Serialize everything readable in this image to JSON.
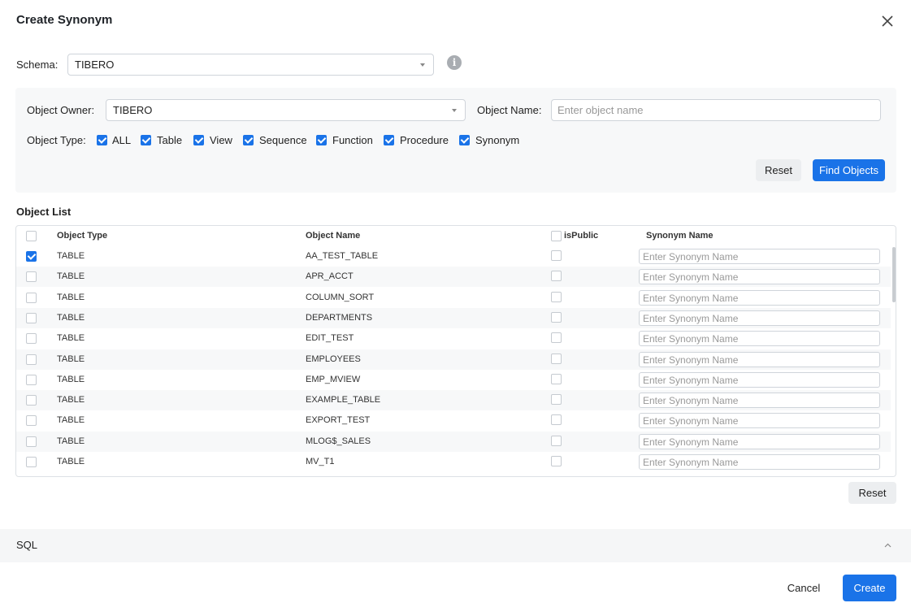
{
  "dialog": {
    "title": "Create Synonym"
  },
  "schema": {
    "label": "Schema:",
    "value": "TIBERO",
    "info_icon": "info-icon"
  },
  "search": {
    "owner_label": "Object Owner:",
    "owner_value": "TIBERO",
    "name_label": "Object Name:",
    "name_placeholder": "Enter object name",
    "type_label": "Object Type:",
    "types": [
      {
        "label": "ALL",
        "checked": true
      },
      {
        "label": "Table",
        "checked": true
      },
      {
        "label": "View",
        "checked": true
      },
      {
        "label": "Sequence",
        "checked": true
      },
      {
        "label": "Function",
        "checked": true
      },
      {
        "label": "Procedure",
        "checked": true
      },
      {
        "label": "Synonym",
        "checked": true
      }
    ],
    "reset_label": "Reset",
    "find_label": "Find Objects"
  },
  "object_list": {
    "title": "Object List",
    "columns": {
      "type": "Object Type",
      "name": "Object Name",
      "public": "isPublic",
      "synonym": "Synonym Name"
    },
    "synonym_placeholder": "Enter Synonym Name",
    "rows": [
      {
        "type": "TABLE",
        "name": "AA_TEST_TABLE",
        "selected": true
      },
      {
        "type": "TABLE",
        "name": "APR_ACCT",
        "selected": false
      },
      {
        "type": "TABLE",
        "name": "COLUMN_SORT",
        "selected": false
      },
      {
        "type": "TABLE",
        "name": "DEPARTMENTS",
        "selected": false
      },
      {
        "type": "TABLE",
        "name": "EDIT_TEST",
        "selected": false
      },
      {
        "type": "TABLE",
        "name": "EMPLOYEES",
        "selected": false
      },
      {
        "type": "TABLE",
        "name": "EMP_MVIEW",
        "selected": false
      },
      {
        "type": "TABLE",
        "name": "EXAMPLE_TABLE",
        "selected": false
      },
      {
        "type": "TABLE",
        "name": "EXPORT_TEST",
        "selected": false
      },
      {
        "type": "TABLE",
        "name": "MLOG$_SALES",
        "selected": false
      },
      {
        "type": "TABLE",
        "name": "MV_T1",
        "selected": false
      }
    ],
    "reset_label": "Reset"
  },
  "sql": {
    "label": "SQL"
  },
  "footer": {
    "cancel_label": "Cancel",
    "create_label": "Create"
  },
  "colors": {
    "accent": "#1a73e8",
    "panel": "#f7f8f9"
  }
}
